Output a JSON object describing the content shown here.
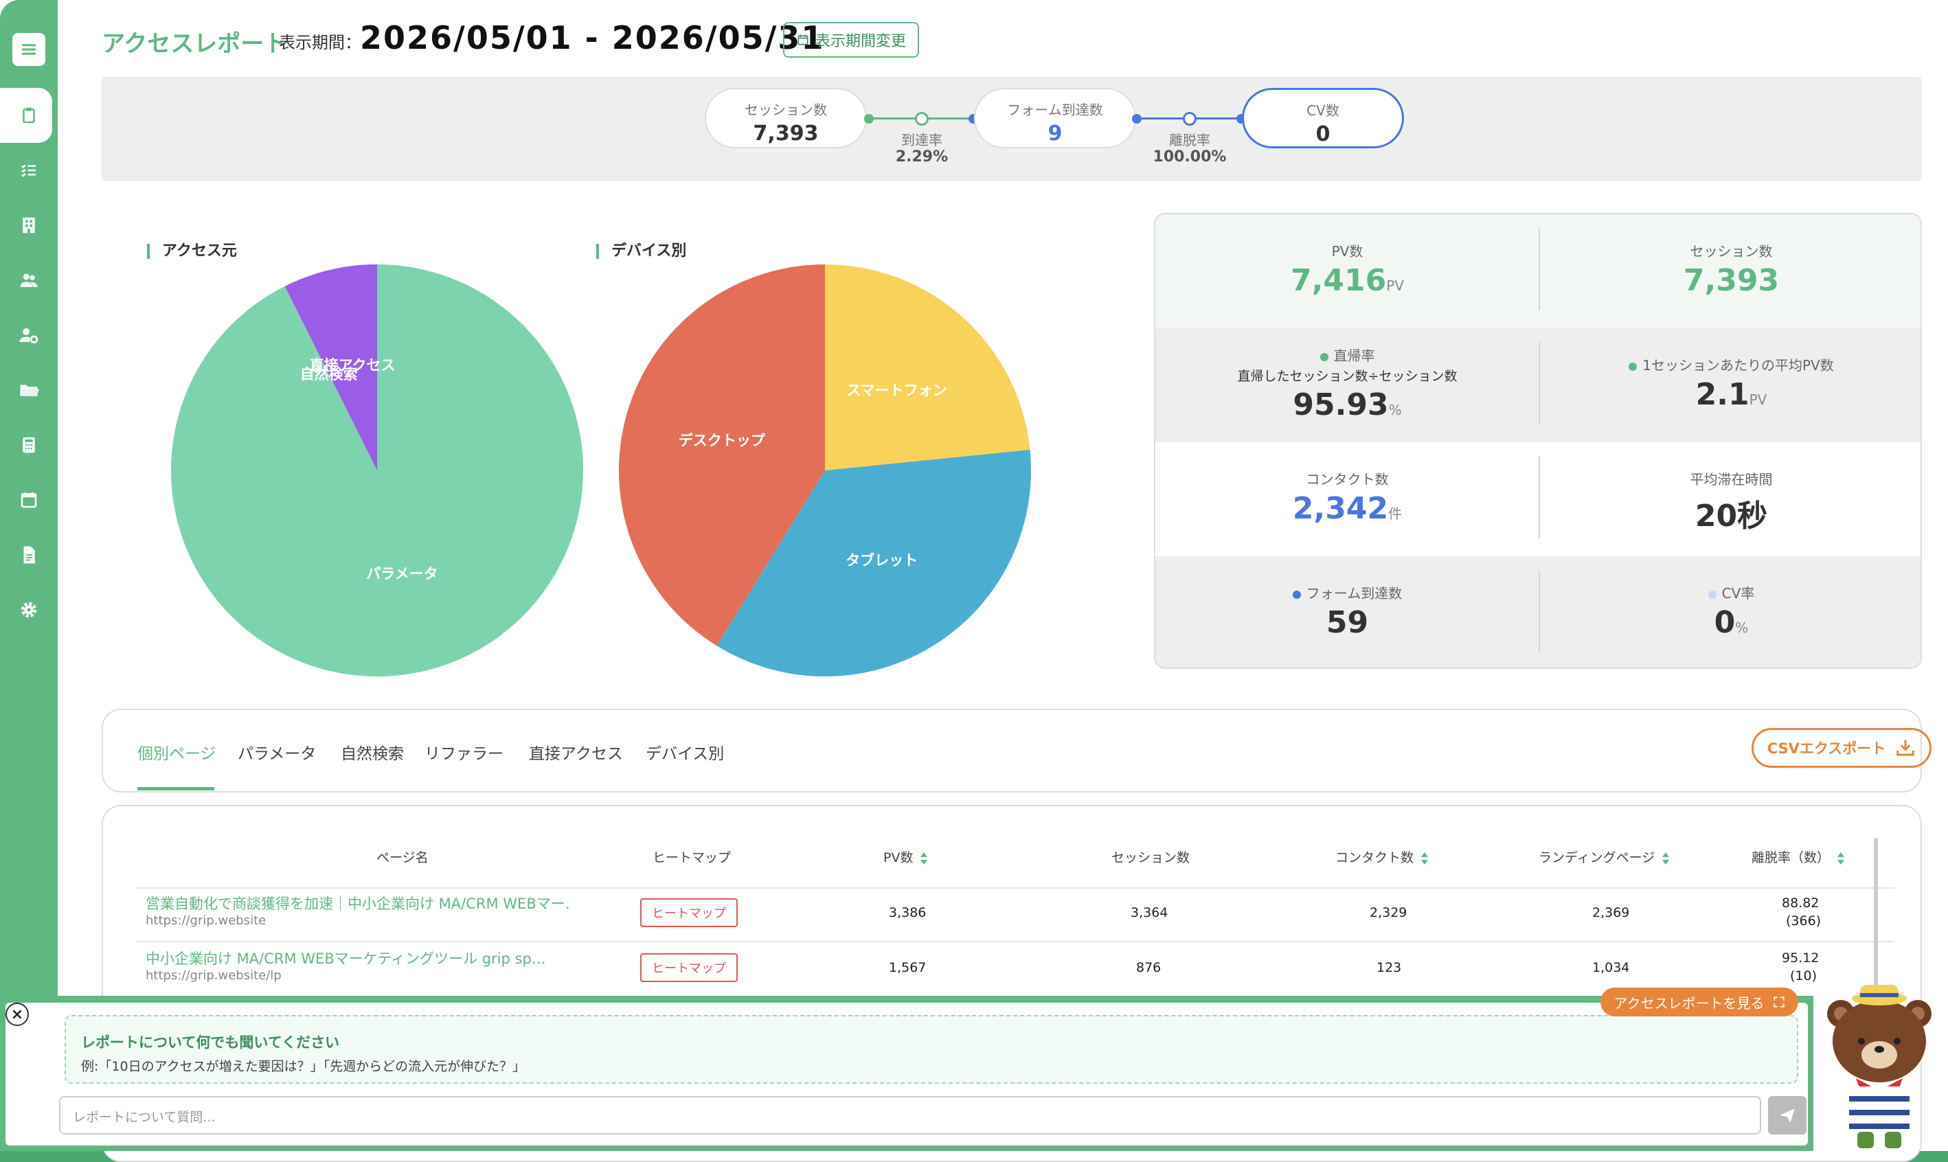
{
  "header": {
    "title": "アクセスレポート",
    "period_label": "表示期間：",
    "period": "2026/05/01 - 2026/05/31",
    "change_button": "表示期間変更"
  },
  "funnel": {
    "sessions": {
      "label": "セッション数",
      "value": "7,393"
    },
    "form_reach": {
      "label": "フォーム到達数",
      "value": "9"
    },
    "cv": {
      "label": "CV数",
      "value": "0"
    },
    "reach_rate": {
      "label": "到達率",
      "value": "2.29%"
    },
    "exit_rate": {
      "label": "離脱率",
      "value": "100.00%"
    },
    "colors": {
      "green": "#5fb882",
      "blue": "#4a76e0"
    }
  },
  "access_source": {
    "title": "アクセス元",
    "chart_data": {
      "type": "pie",
      "labels": [
        "パラメータ",
        "自然検索",
        "直接アクセス"
      ],
      "values": [
        92.5,
        0.1,
        7.4
      ],
      "colors": [
        "#7dd3ae",
        "#7dd3ae",
        "#9b5de5"
      ]
    }
  },
  "device": {
    "title": "デバイス別",
    "chart_data": {
      "type": "pie",
      "labels": [
        "スマートフォン",
        "タブレット",
        "デスクトップ"
      ],
      "values": [
        23.4,
        35.4,
        41.2
      ],
      "colors": [
        "#f7d35c",
        "#4baed1",
        "#e36f58"
      ]
    }
  },
  "stats": {
    "pv": {
      "label": "PV数",
      "value": "7,416",
      "unit": "PV"
    },
    "sessions": {
      "label": "セッション数",
      "value": "7,393"
    },
    "bounce": {
      "label": "直帰率",
      "sub": "直帰したセッション数÷セッション数",
      "value": "95.93",
      "unit": "%"
    },
    "avg_pv": {
      "label": "1セッションあたりの平均PV数",
      "value": "2.1",
      "unit": "PV"
    },
    "contacts": {
      "label": "コンタクト数",
      "value": "2,342",
      "unit": "件"
    },
    "avg_time": {
      "label": "平均滞在時間",
      "value": "20秒"
    },
    "form_reach": {
      "label": "フォーム到達数",
      "value": "59"
    },
    "cv_rate": {
      "label": "CV率",
      "value": "0",
      "unit": "%"
    }
  },
  "tabs": [
    "個別ページ",
    "パラメータ",
    "自然検索",
    "リファラー",
    "直接アクセス",
    "デバイス別"
  ],
  "csv_button": "CSVエクスポート",
  "table": {
    "headers": [
      "ページ名",
      "ヒートマップ",
      "PV数",
      "セッション数",
      "コンタクト数",
      "ランディングページ",
      "離脱率（数）"
    ],
    "rows": [
      {
        "name": "営業自動化で商談獲得を加速｜中小企業向け MA/CRM WEBマー…",
        "url": "https://grip.website",
        "heatmap": "ヒートマップ",
        "pv": "3,386",
        "sessions": "3,364",
        "contacts": "2,329",
        "landing": "2,369",
        "exit_rate": "88.82",
        "exit_count": "(366)"
      },
      {
        "name": "中小企業向け MA/CRM WEBマーケティングツール grip sp…",
        "url": "https://grip.website/lp",
        "heatmap": "ヒートマップ",
        "pv": "1,567",
        "sessions": "876",
        "contacts": "123",
        "landing": "1,034",
        "exit_rate": "95.12",
        "exit_count": "(10)"
      }
    ]
  },
  "chat": {
    "hint_title": "レポートについて何でも聞いてください",
    "hint_example": "例:「10日のアクセスが増えた要因は？」「先週からどの流入元が伸びた？」",
    "placeholder": "レポートについて質問...",
    "view_button": "アクセスレポートを見る"
  }
}
